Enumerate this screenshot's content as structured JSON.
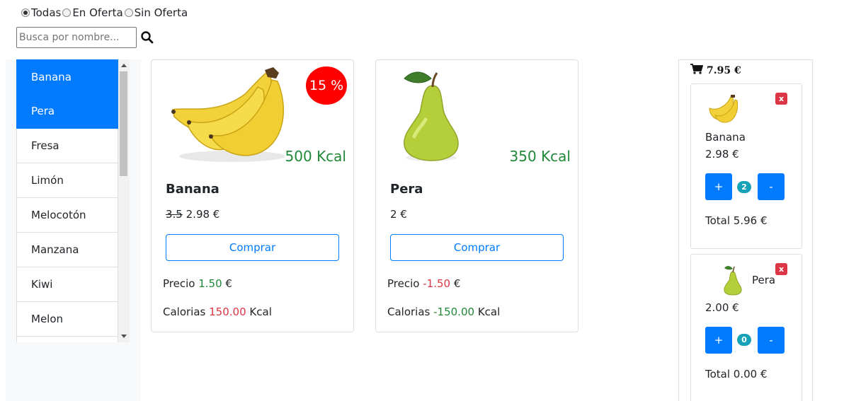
{
  "filters": [
    {
      "label": "Todas",
      "checked": true
    },
    {
      "label": "En Oferta",
      "checked": false
    },
    {
      "label": "Sin Oferta",
      "checked": false
    }
  ],
  "search": {
    "placeholder": "Busca por nombre..."
  },
  "fruit_list": [
    "Banana",
    "Pera",
    "Fresa",
    "Limón",
    "Melocotón",
    "Manzana",
    "Kiwi",
    "Melon"
  ],
  "selected_fruits": [
    "Banana",
    "Pera"
  ],
  "products": [
    {
      "name": "Banana",
      "kcal": "500 Kcal",
      "discount": "15 %",
      "old_price": "3.5",
      "price": "2.98 €",
      "buy_label": "Comprar",
      "precio_label": "Precio",
      "precio_value": "1.50",
      "precio_unit": "€",
      "calorias_label": "Calorias",
      "calorias_value": "150.00",
      "calorias_unit": "Kcal"
    },
    {
      "name": "Pera",
      "kcal": "350 Kcal",
      "price": "2 €",
      "buy_label": "Comprar",
      "precio_label": "Precio",
      "precio_value": "-1.50",
      "precio_unit": "€",
      "calorias_label": "Calorias",
      "calorias_value": "-150.00",
      "calorias_unit": "Kcal"
    }
  ],
  "cart": {
    "total": "7.95 €",
    "items": [
      {
        "name": "Banana",
        "price": "2.98 €",
        "plus": "+",
        "quantity": "2",
        "minus": "-",
        "total": "Total 5.96 €",
        "remove": "x"
      },
      {
        "name": "Pera",
        "price": "2.00 €",
        "plus": "+",
        "quantity": "0",
        "minus": "-",
        "total": "Total 0.00 €",
        "remove": "x"
      }
    ]
  },
  "colors": {
    "primary": "#007bff",
    "discount_badge": "#ff0000",
    "positive": "#218838",
    "negative": "#dc3545",
    "quantity_badge": "#17a2b8"
  }
}
